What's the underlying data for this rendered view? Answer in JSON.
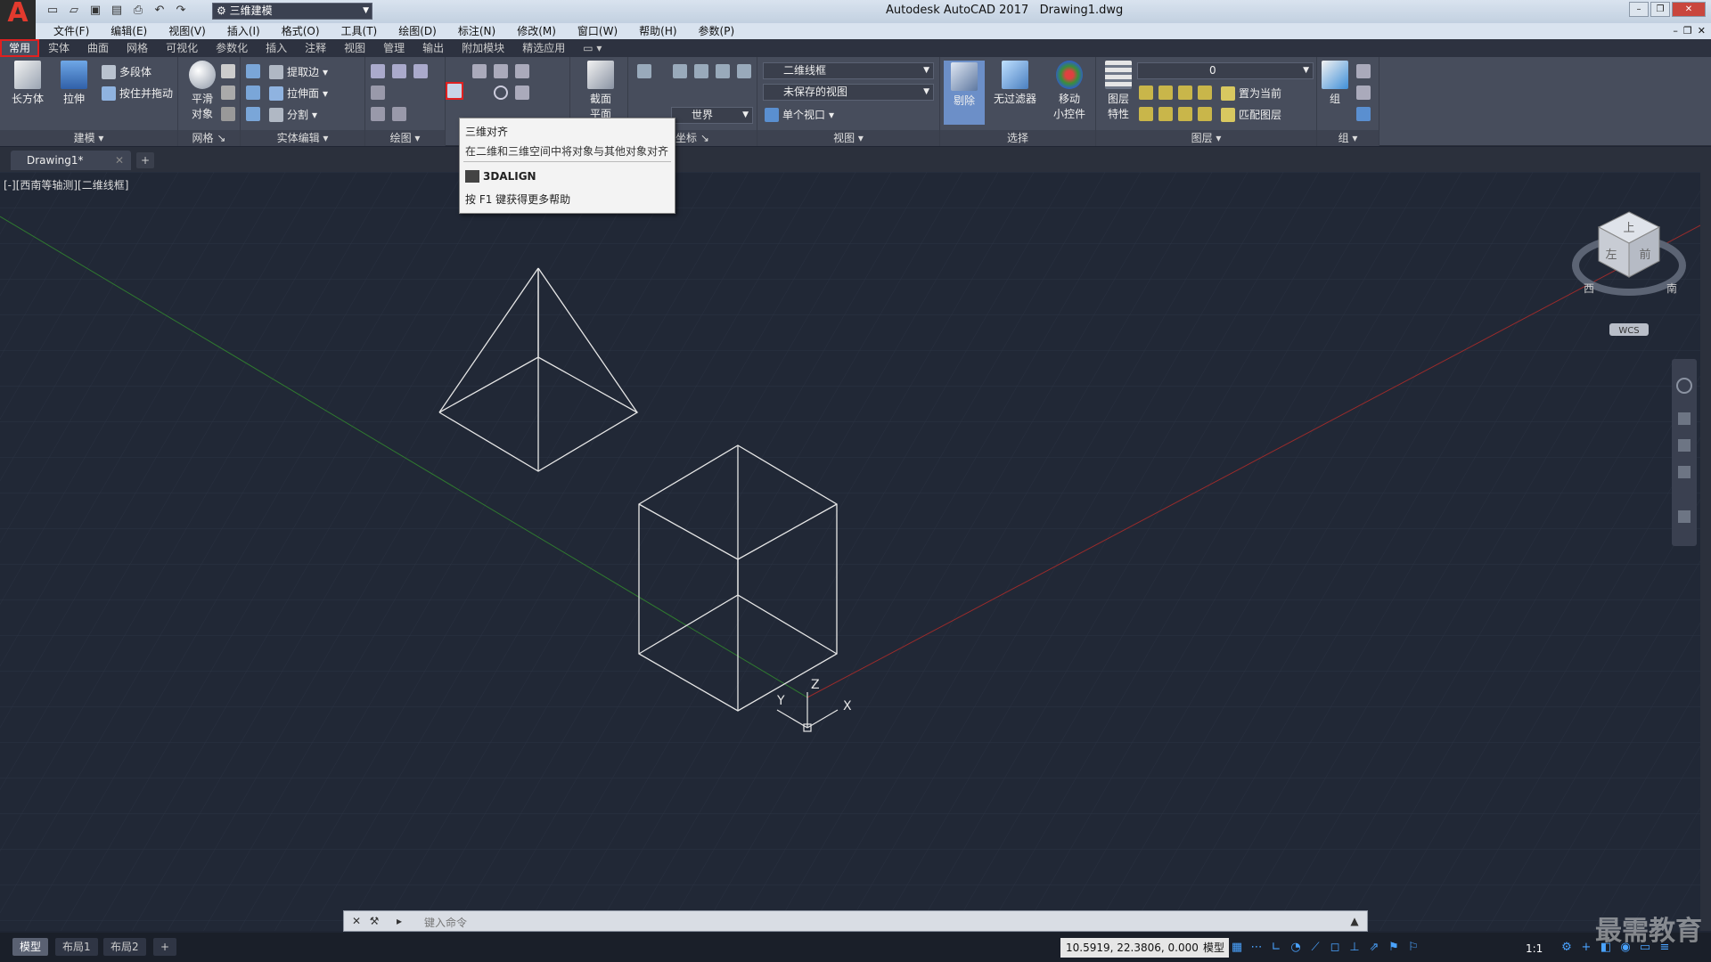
{
  "titlebar": {
    "workspace": "三维建模",
    "app_title": "Autodesk AutoCAD 2017",
    "document_title": "Drawing1.dwg"
  },
  "menu": [
    "文件(F)",
    "编辑(E)",
    "视图(V)",
    "插入(I)",
    "格式(O)",
    "工具(T)",
    "绘图(D)",
    "标注(N)",
    "修改(M)",
    "窗口(W)",
    "帮助(H)",
    "参数(P)"
  ],
  "ribbon_tabs": [
    "常用",
    "实体",
    "曲面",
    "网格",
    "可视化",
    "参数化",
    "插入",
    "注释",
    "视图",
    "管理",
    "输出",
    "附加模块",
    "精选应用"
  ],
  "active_tab": "常用",
  "ribbon": {
    "build": {
      "title": "建模",
      "box": "长方体",
      "extrude": "拉伸",
      "polysolid": "多段体",
      "presspull": "按住并拖动"
    },
    "mesh": {
      "title": "网格",
      "smooth_1": "平滑",
      "smooth_2": "对象"
    },
    "solid_edit": {
      "title": "实体编辑",
      "extract_edges": "提取边",
      "extrude_face": "拉伸面",
      "separate": "分割"
    },
    "draw": {
      "title": "绘图"
    },
    "section": {
      "label_1": "截面",
      "label_2": "平面"
    },
    "coords": {
      "title": "坐标",
      "world": "世界"
    },
    "view": {
      "title": "视图",
      "visual_style": "二维线框",
      "saved_view": "未保存的视图",
      "viewport": "单个视口"
    },
    "selection": {
      "title": "选择",
      "cull": "剔除",
      "no_filter": "无过滤器",
      "gizmo_1": "移动",
      "gizmo_2": "小控件"
    },
    "layers": {
      "title": "图层",
      "props_1": "图层",
      "props_2": "特性",
      "current_layer": "0",
      "set_current": "置为当前",
      "match_layer": "匹配图层"
    },
    "group": {
      "title": "组",
      "label": "组"
    }
  },
  "tooltip": {
    "title": "三维对齐",
    "description": "在二维和三维空间中将对象与其他对象对齐",
    "command": "3DALIGN",
    "help": "按 F1 键获得更多帮助"
  },
  "document_tab": "Drawing1*",
  "viewport_label": "[-][西南等轴测][二维线框]",
  "viewcube": {
    "top": "上",
    "left": "左",
    "front": "前",
    "west": "西",
    "south": "南",
    "wcs": "WCS"
  },
  "ucs_axes": {
    "x": "X",
    "y": "Y",
    "z": "Z"
  },
  "command_prompt": "键入命令",
  "layout_tabs": [
    "模型",
    "布局1",
    "布局2"
  ],
  "status": {
    "coordinates": "10.5919, 22.3806, 0.0000",
    "model": "模型",
    "scale": "1:1"
  },
  "watermark": "最需教育",
  "colors": {
    "viewport_bg": "#212836",
    "ribbon_bg": "#474d5c",
    "annotation_red": "#e02020",
    "x_axis": "#9a2b2b",
    "y_axis": "#2f7a2f"
  }
}
